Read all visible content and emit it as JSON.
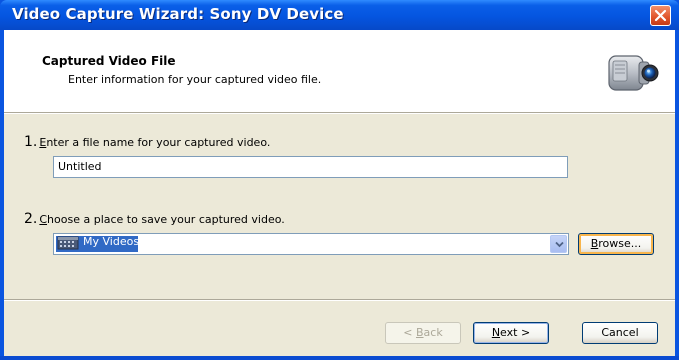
{
  "window": {
    "title": "Video Capture Wizard: Sony DV Device"
  },
  "header": {
    "title": "Captured Video File",
    "subtitle": "Enter information for your captured video file.",
    "icon": "camcorder-icon"
  },
  "steps": [
    {
      "number": "1.",
      "mnemonic": "E",
      "label_rest": "nter a file name for your captured video.",
      "input_value": "Untitled"
    },
    {
      "number": "2.",
      "mnemonic": "C",
      "label_rest": "hoose a place to save your captured video.",
      "selected_location": "My Videos",
      "browse_mnemonic": "B",
      "browse_rest": "rowse..."
    }
  ],
  "buttons": {
    "back": {
      "prefix": "< ",
      "mnemonic": "B",
      "rest": "ack"
    },
    "next": {
      "mnemonic": "N",
      "rest": "ext >"
    },
    "cancel": "Cancel"
  },
  "colors": {
    "titlebar": "#0555e0",
    "dialog_bg": "#ece9d8",
    "selection": "#316ac5",
    "focus_ring": "#f8b54c",
    "close_button": "#e0542a"
  }
}
